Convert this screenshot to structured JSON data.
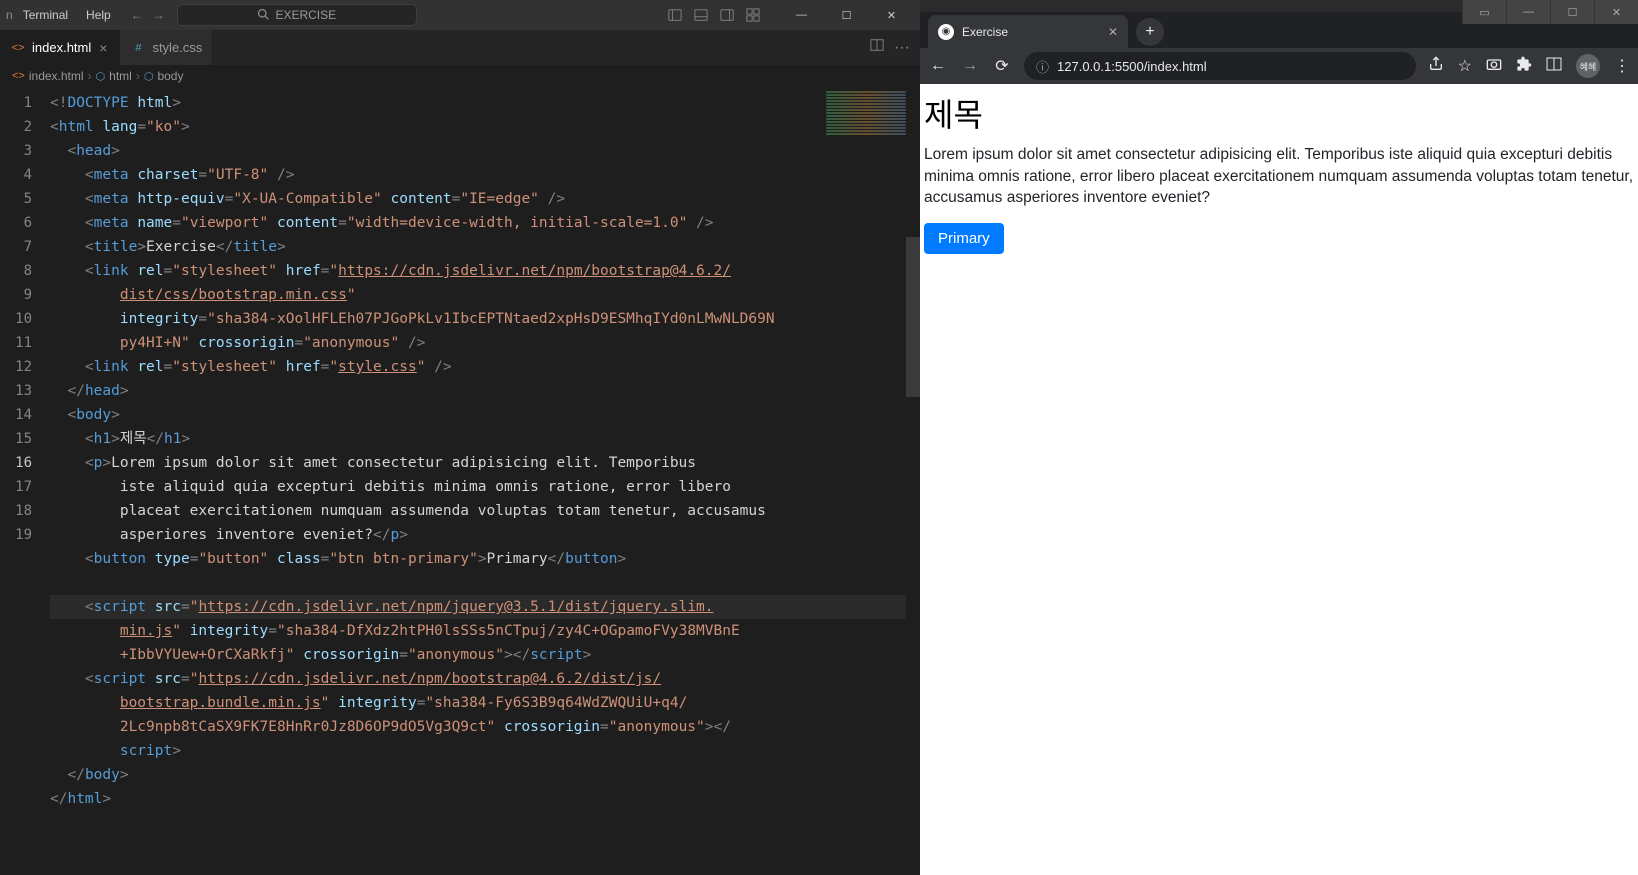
{
  "menubar": {
    "items": [
      "Terminal",
      "Help"
    ],
    "truncated_prefix": "n"
  },
  "searchbox": {
    "text": "EXERCISE"
  },
  "tabs": [
    {
      "label": "index.html",
      "icon": "html",
      "active": true,
      "close": true
    },
    {
      "label": "style.css",
      "icon": "css",
      "active": false,
      "close": false
    }
  ],
  "breadcrumbs": [
    {
      "label": "index.html",
      "icon": "html"
    },
    {
      "label": "html",
      "icon": "tag"
    },
    {
      "label": "body",
      "icon": "tag"
    }
  ],
  "gutter": [
    "1",
    "2",
    "3",
    "4",
    "5",
    "6",
    "7",
    "8",
    "",
    "",
    "9",
    "10",
    "11",
    "12",
    "13",
    "",
    "",
    "",
    "14",
    "15",
    "16",
    "",
    "",
    "17",
    "",
    "",
    "",
    "18",
    "19"
  ],
  "active_gutter_index": 20,
  "code_tokens": [
    [
      [
        "<!",
        "punct"
      ],
      [
        "DOCTYPE",
        "doctype"
      ],
      [
        " ",
        "punct"
      ],
      [
        "html",
        "attr"
      ],
      [
        ">",
        "punct"
      ]
    ],
    [
      [
        "<",
        "punct"
      ],
      [
        "html",
        "tag"
      ],
      [
        " ",
        "punct"
      ],
      [
        "lang",
        "attr"
      ],
      [
        "=",
        "punct"
      ],
      [
        "\"ko\"",
        "str"
      ],
      [
        ">",
        "punct"
      ]
    ],
    [
      [
        "  <",
        "punct"
      ],
      [
        "head",
        "tag"
      ],
      [
        ">",
        "punct"
      ]
    ],
    [
      [
        "    <",
        "punct"
      ],
      [
        "meta",
        "tag"
      ],
      [
        " ",
        "punct"
      ],
      [
        "charset",
        "attr"
      ],
      [
        "=",
        "punct"
      ],
      [
        "\"UTF-8\"",
        "str"
      ],
      [
        " />",
        "punct"
      ]
    ],
    [
      [
        "    <",
        "punct"
      ],
      [
        "meta",
        "tag"
      ],
      [
        " ",
        "punct"
      ],
      [
        "http-equiv",
        "attr"
      ],
      [
        "=",
        "punct"
      ],
      [
        "\"X-UA-Compatible\"",
        "str"
      ],
      [
        " ",
        "punct"
      ],
      [
        "content",
        "attr"
      ],
      [
        "=",
        "punct"
      ],
      [
        "\"IE=edge\"",
        "str"
      ],
      [
        " />",
        "punct"
      ]
    ],
    [
      [
        "    <",
        "punct"
      ],
      [
        "meta",
        "tag"
      ],
      [
        " ",
        "punct"
      ],
      [
        "name",
        "attr"
      ],
      [
        "=",
        "punct"
      ],
      [
        "\"viewport\"",
        "str"
      ],
      [
        " ",
        "punct"
      ],
      [
        "content",
        "attr"
      ],
      [
        "=",
        "punct"
      ],
      [
        "\"width=device-width, initial-scale=1.0\"",
        "str"
      ],
      [
        " />",
        "punct"
      ]
    ],
    [
      [
        "    <",
        "punct"
      ],
      [
        "title",
        "tag"
      ],
      [
        ">",
        "punct"
      ],
      [
        "Exercise",
        "text"
      ],
      [
        "</",
        "punct"
      ],
      [
        "title",
        "tag"
      ],
      [
        ">",
        "punct"
      ]
    ],
    [
      [
        "    <",
        "punct"
      ],
      [
        "link",
        "tag"
      ],
      [
        " ",
        "punct"
      ],
      [
        "rel",
        "attr"
      ],
      [
        "=",
        "punct"
      ],
      [
        "\"stylesheet\"",
        "str"
      ],
      [
        " ",
        "punct"
      ],
      [
        "href",
        "attr"
      ],
      [
        "=",
        "punct"
      ],
      [
        "\"",
        "str"
      ],
      [
        "https://cdn.jsdelivr.net/npm/bootstrap@4.6.2/",
        "link"
      ]
    ],
    [
      [
        "dist/css/bootstrap.min.css",
        "link"
      ],
      [
        "\"",
        "str"
      ]
    ],
    [
      [
        "integrity",
        "attr"
      ],
      [
        "=",
        "punct"
      ],
      [
        "\"sha384-xOolHFLEh07PJGoPkLv1IbcEPTNtaed2xpHsD9ESMhqIYd0nLMwNLD69N",
        "str"
      ]
    ],
    [
      [
        "py4HI+N\"",
        "str"
      ],
      [
        " ",
        "punct"
      ],
      [
        "crossorigin",
        "attr"
      ],
      [
        "=",
        "punct"
      ],
      [
        "\"anonymous\"",
        "str"
      ],
      [
        " />",
        "punct"
      ]
    ],
    [
      [
        "    <",
        "punct"
      ],
      [
        "link",
        "tag"
      ],
      [
        " ",
        "punct"
      ],
      [
        "rel",
        "attr"
      ],
      [
        "=",
        "punct"
      ],
      [
        "\"stylesheet\"",
        "str"
      ],
      [
        " ",
        "punct"
      ],
      [
        "href",
        "attr"
      ],
      [
        "=",
        "punct"
      ],
      [
        "\"",
        "str"
      ],
      [
        "style.css",
        "link"
      ],
      [
        "\"",
        "str"
      ],
      [
        " />",
        "punct"
      ]
    ],
    [
      [
        "  </",
        "punct"
      ],
      [
        "head",
        "tag"
      ],
      [
        ">",
        "punct"
      ]
    ],
    [
      [
        "  <",
        "punct"
      ],
      [
        "body",
        "tag"
      ],
      [
        ">",
        "punct"
      ]
    ],
    [
      [
        "    <",
        "punct"
      ],
      [
        "h1",
        "tag"
      ],
      [
        ">",
        "punct"
      ],
      [
        "제목",
        "text"
      ],
      [
        "</",
        "punct"
      ],
      [
        "h1",
        "tag"
      ],
      [
        ">",
        "punct"
      ]
    ],
    [
      [
        "    <",
        "punct"
      ],
      [
        "p",
        "tag"
      ],
      [
        ">",
        "punct"
      ],
      [
        "Lorem ipsum dolor sit amet consectetur adipisicing elit. Temporibus",
        "text"
      ]
    ],
    [
      [
        "iste aliquid quia excepturi debitis minima omnis ratione, error libero",
        "text"
      ]
    ],
    [
      [
        "placeat exercitationem numquam assumenda voluptas totam tenetur, accusamus",
        "text"
      ]
    ],
    [
      [
        "asperiores inventore eveniet?",
        "text"
      ],
      [
        "</",
        "punct"
      ],
      [
        "p",
        "tag"
      ],
      [
        ">",
        "punct"
      ]
    ],
    [
      [
        "    <",
        "punct"
      ],
      [
        "button",
        "tag"
      ],
      [
        " ",
        "punct"
      ],
      [
        "type",
        "attr"
      ],
      [
        "=",
        "punct"
      ],
      [
        "\"button\"",
        "str"
      ],
      [
        " ",
        "punct"
      ],
      [
        "class",
        "attr"
      ],
      [
        "=",
        "punct"
      ],
      [
        "\"btn btn-primary\"",
        "str"
      ],
      [
        ">",
        "punct"
      ],
      [
        "Primary",
        "text"
      ],
      [
        "</",
        "punct"
      ],
      [
        "button",
        "tag"
      ],
      [
        ">",
        "punct"
      ]
    ],
    [],
    [
      [
        "    <",
        "punct"
      ],
      [
        "script",
        "tag"
      ],
      [
        " ",
        "punct"
      ],
      [
        "src",
        "attr"
      ],
      [
        "=",
        "punct"
      ],
      [
        "\"",
        "str"
      ],
      [
        "https://cdn.jsdelivr.net/npm/jquery@3.5.1/dist/jquery.slim.",
        "link"
      ]
    ],
    [
      [
        "min.js",
        "link"
      ],
      [
        "\"",
        "str"
      ],
      [
        " ",
        "punct"
      ],
      [
        "integrity",
        "attr"
      ],
      [
        "=",
        "punct"
      ],
      [
        "\"sha384-DfXdz2htPH0lsSSs5nCTpuj/zy4C+OGpamoFVy38MVBnE",
        "str"
      ]
    ],
    [
      [
        "+IbbVYUew+OrCXaRkfj\"",
        "str"
      ],
      [
        " ",
        "punct"
      ],
      [
        "crossorigin",
        "attr"
      ],
      [
        "=",
        "punct"
      ],
      [
        "\"anonymous\"",
        "str"
      ],
      [
        "></",
        "punct"
      ],
      [
        "script",
        "tag"
      ],
      [
        ">",
        "punct"
      ]
    ],
    [
      [
        "    <",
        "punct"
      ],
      [
        "script",
        "tag"
      ],
      [
        " ",
        "punct"
      ],
      [
        "src",
        "attr"
      ],
      [
        "=",
        "punct"
      ],
      [
        "\"",
        "str"
      ],
      [
        "https://cdn.jsdelivr.net/npm/bootstrap@4.6.2/dist/js/",
        "link"
      ]
    ],
    [
      [
        "bootstrap.bundle.min.js",
        "link"
      ],
      [
        "\"",
        "str"
      ],
      [
        " ",
        "punct"
      ],
      [
        "integrity",
        "attr"
      ],
      [
        "=",
        "punct"
      ],
      [
        "\"sha384-Fy6S3B9q64WdZWQUiU+q4/",
        "str"
      ]
    ],
    [
      [
        "2Lc9npb8tCaSX9FK7E8HnRr0Jz8D6OP9dO5Vg3Q9ct\"",
        "str"
      ],
      [
        " ",
        "punct"
      ],
      [
        "crossorigin",
        "attr"
      ],
      [
        "=",
        "punct"
      ],
      [
        "\"anonymous\"",
        "str"
      ],
      [
        "></",
        "punct"
      ]
    ],
    [
      [
        "script",
        "tag"
      ],
      [
        ">",
        "punct"
      ]
    ],
    [
      [
        "  </",
        "punct"
      ],
      [
        "body",
        "tag"
      ],
      [
        ">",
        "punct"
      ]
    ],
    [
      [
        "</",
        "punct"
      ],
      [
        "html",
        "tag"
      ],
      [
        ">",
        "punct"
      ]
    ]
  ],
  "code_indent": [
    0,
    0,
    0,
    0,
    0,
    0,
    0,
    0,
    4,
    4,
    4,
    0,
    0,
    0,
    0,
    0,
    4,
    4,
    4,
    0,
    0,
    0,
    4,
    4,
    0,
    4,
    4,
    4,
    0,
    0
  ],
  "code_highlight_index": 21,
  "browser": {
    "tab_title": "Exercise",
    "url": "127.0.0.1:5500/index.html",
    "page": {
      "heading": "제목",
      "paragraph": "Lorem ipsum dolor sit amet consectetur adipisicing elit. Temporibus iste aliquid quia excepturi debitis minima omnis ratione, error libero placeat exercitationem numquam assumenda voluptas totam tenetur, accusamus asperiores inventore eveniet?",
      "button": "Primary"
    },
    "avatar": "혜혜"
  }
}
